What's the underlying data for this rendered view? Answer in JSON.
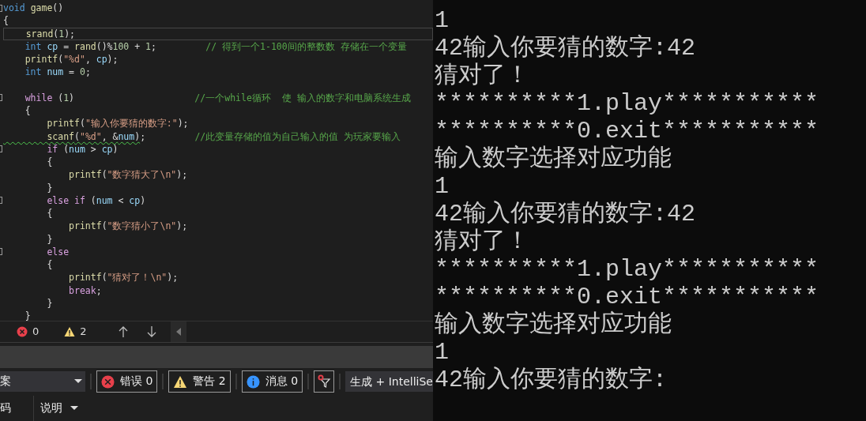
{
  "editor": {
    "lines": [
      {
        "fold": true,
        "current": false,
        "tokens": [
          {
            "t": "void",
            "kind": "keyword"
          },
          {
            "t": " game",
            "kind": "function"
          },
          {
            "t": "()",
            "kind": "plain"
          }
        ]
      },
      {
        "fold": false,
        "current": false,
        "tokens": [
          {
            "t": "{",
            "kind": "plain"
          }
        ]
      },
      {
        "fold": false,
        "current": true,
        "tokens": [
          {
            "t": "    srand",
            "kind": "function"
          },
          {
            "t": "(",
            "kind": "plain"
          },
          {
            "t": "1",
            "kind": "number"
          },
          {
            "t": ");",
            "kind": "plain"
          }
        ]
      },
      {
        "fold": false,
        "current": false,
        "tokens": [
          {
            "t": "    int",
            "kind": "keyword"
          },
          {
            "t": " cp",
            "kind": "variable"
          },
          {
            "t": " = ",
            "kind": "plain"
          },
          {
            "t": "rand",
            "kind": "function"
          },
          {
            "t": "()%",
            "kind": "plain"
          },
          {
            "t": "100",
            "kind": "number"
          },
          {
            "t": " + ",
            "kind": "plain"
          },
          {
            "t": "1",
            "kind": "number"
          },
          {
            "t": ";         ",
            "kind": "plain"
          },
          {
            "t": "// 得到一个1-100间的整数数 存储在一个变量",
            "kind": "comment"
          }
        ]
      },
      {
        "fold": false,
        "current": false,
        "tokens": [
          {
            "t": "    printf",
            "kind": "function"
          },
          {
            "t": "(",
            "kind": "plain"
          },
          {
            "t": "\"%d\"",
            "kind": "string"
          },
          {
            "t": ", ",
            "kind": "plain"
          },
          {
            "t": "cp",
            "kind": "variable"
          },
          {
            "t": ");",
            "kind": "plain"
          }
        ]
      },
      {
        "fold": false,
        "current": false,
        "tokens": [
          {
            "t": "    int",
            "kind": "keyword"
          },
          {
            "t": " num",
            "kind": "variable"
          },
          {
            "t": " = ",
            "kind": "plain"
          },
          {
            "t": "0",
            "kind": "number"
          },
          {
            "t": ";",
            "kind": "plain"
          }
        ]
      },
      {
        "fold": true,
        "current": false,
        "blank_before": true,
        "tokens": [
          {
            "t": "    while",
            "kind": "control"
          },
          {
            "t": " (",
            "kind": "plain"
          },
          {
            "t": "1",
            "kind": "number"
          },
          {
            "t": ")                      ",
            "kind": "plain"
          },
          {
            "t": "//一个while循环  使 输入的数字和电脑系统生成",
            "kind": "comment"
          }
        ]
      },
      {
        "fold": false,
        "current": false,
        "tokens": [
          {
            "t": "    {",
            "kind": "plain"
          }
        ]
      },
      {
        "fold": false,
        "current": false,
        "tokens": [
          {
            "t": "        printf",
            "kind": "function"
          },
          {
            "t": "(",
            "kind": "plain"
          },
          {
            "t": "\"输入你要猜的数字:\"",
            "kind": "string"
          },
          {
            "t": ");",
            "kind": "plain"
          }
        ]
      },
      {
        "fold": false,
        "current": false,
        "tokens": [
          {
            "t": "        scanf",
            "kind": "function",
            "squiggle": true
          },
          {
            "t": "(",
            "kind": "plain",
            "squiggle": true
          },
          {
            "t": "\"%d\"",
            "kind": "string",
            "squiggle": true
          },
          {
            "t": ", &",
            "kind": "plain",
            "squiggle": true
          },
          {
            "t": "num",
            "kind": "variable",
            "squiggle": true
          },
          {
            "t": ")",
            "kind": "plain",
            "squiggle": true
          },
          {
            "t": ";         ",
            "kind": "plain"
          },
          {
            "t": "//此变量存储的值为自己输入的值 为玩家要输入",
            "kind": "comment"
          }
        ]
      },
      {
        "fold": true,
        "current": false,
        "tokens": [
          {
            "t": "        if",
            "kind": "control"
          },
          {
            "t": " (",
            "kind": "plain"
          },
          {
            "t": "num",
            "kind": "variable"
          },
          {
            "t": " > ",
            "kind": "plain"
          },
          {
            "t": "cp",
            "kind": "variable"
          },
          {
            "t": ")",
            "kind": "plain"
          }
        ]
      },
      {
        "fold": false,
        "current": false,
        "tokens": [
          {
            "t": "        {",
            "kind": "plain"
          }
        ]
      },
      {
        "fold": false,
        "current": false,
        "tokens": [
          {
            "t": "            printf",
            "kind": "function"
          },
          {
            "t": "(",
            "kind": "plain"
          },
          {
            "t": "\"数字猜大了\\n\"",
            "kind": "string"
          },
          {
            "t": ");",
            "kind": "plain"
          }
        ]
      },
      {
        "fold": false,
        "current": false,
        "tokens": [
          {
            "t": "        }",
            "kind": "plain"
          }
        ]
      },
      {
        "fold": true,
        "current": false,
        "tokens": [
          {
            "t": "        else if",
            "kind": "control"
          },
          {
            "t": " (",
            "kind": "plain"
          },
          {
            "t": "num",
            "kind": "variable"
          },
          {
            "t": " < ",
            "kind": "plain"
          },
          {
            "t": "cp",
            "kind": "variable"
          },
          {
            "t": ")",
            "kind": "plain"
          }
        ]
      },
      {
        "fold": false,
        "current": false,
        "tokens": [
          {
            "t": "        {",
            "kind": "plain"
          }
        ]
      },
      {
        "fold": false,
        "current": false,
        "tokens": [
          {
            "t": "            printf",
            "kind": "function"
          },
          {
            "t": "(",
            "kind": "plain"
          },
          {
            "t": "\"数字猜小了\\n\"",
            "kind": "string"
          },
          {
            "t": ");",
            "kind": "plain"
          }
        ]
      },
      {
        "fold": false,
        "current": false,
        "tokens": [
          {
            "t": "        }",
            "kind": "plain"
          }
        ]
      },
      {
        "fold": true,
        "current": false,
        "tokens": [
          {
            "t": "        else",
            "kind": "control"
          }
        ]
      },
      {
        "fold": false,
        "current": false,
        "tokens": [
          {
            "t": "        {",
            "kind": "plain"
          }
        ]
      },
      {
        "fold": false,
        "current": false,
        "tokens": [
          {
            "t": "            printf",
            "kind": "function"
          },
          {
            "t": "(",
            "kind": "plain"
          },
          {
            "t": "\"猜对了！\\n\"",
            "kind": "string"
          },
          {
            "t": ");",
            "kind": "plain"
          }
        ]
      },
      {
        "fold": false,
        "current": false,
        "tokens": [
          {
            "t": "            break",
            "kind": "control"
          },
          {
            "t": ";",
            "kind": "plain"
          }
        ]
      },
      {
        "fold": false,
        "current": false,
        "tokens": [
          {
            "t": "        }",
            "kind": "plain"
          }
        ]
      },
      {
        "fold": false,
        "current": false,
        "tokens": [
          {
            "t": "    }",
            "kind": "plain"
          }
        ]
      }
    ]
  },
  "status_strip": {
    "errors": "0",
    "warnings": "2"
  },
  "error_list": {
    "scope": "案",
    "filters": [
      {
        "kind": "error",
        "label": "错误 0",
        "selected": true
      },
      {
        "kind": "warning",
        "label": "警告 2",
        "selected": true
      },
      {
        "kind": "info",
        "label": "消息 0",
        "selected": true
      }
    ],
    "source": "生成 + IntelliSe",
    "columns": [
      {
        "label": "码",
        "sortable": false
      },
      {
        "label": "说明",
        "sortable": true
      }
    ]
  },
  "console": {
    "lines": [
      "1",
      "42输入你要猜的数字:42",
      "猜对了！",
      "**********1.play***********",
      "**********0.exit***********",
      "输入数字选择对应功能",
      "1",
      "42输入你要猜的数字:42",
      "猜对了！",
      "**********1.play***********",
      "**********0.exit***********",
      "输入数字选择对应功能",
      "1",
      "42输入你要猜的数字:"
    ]
  }
}
